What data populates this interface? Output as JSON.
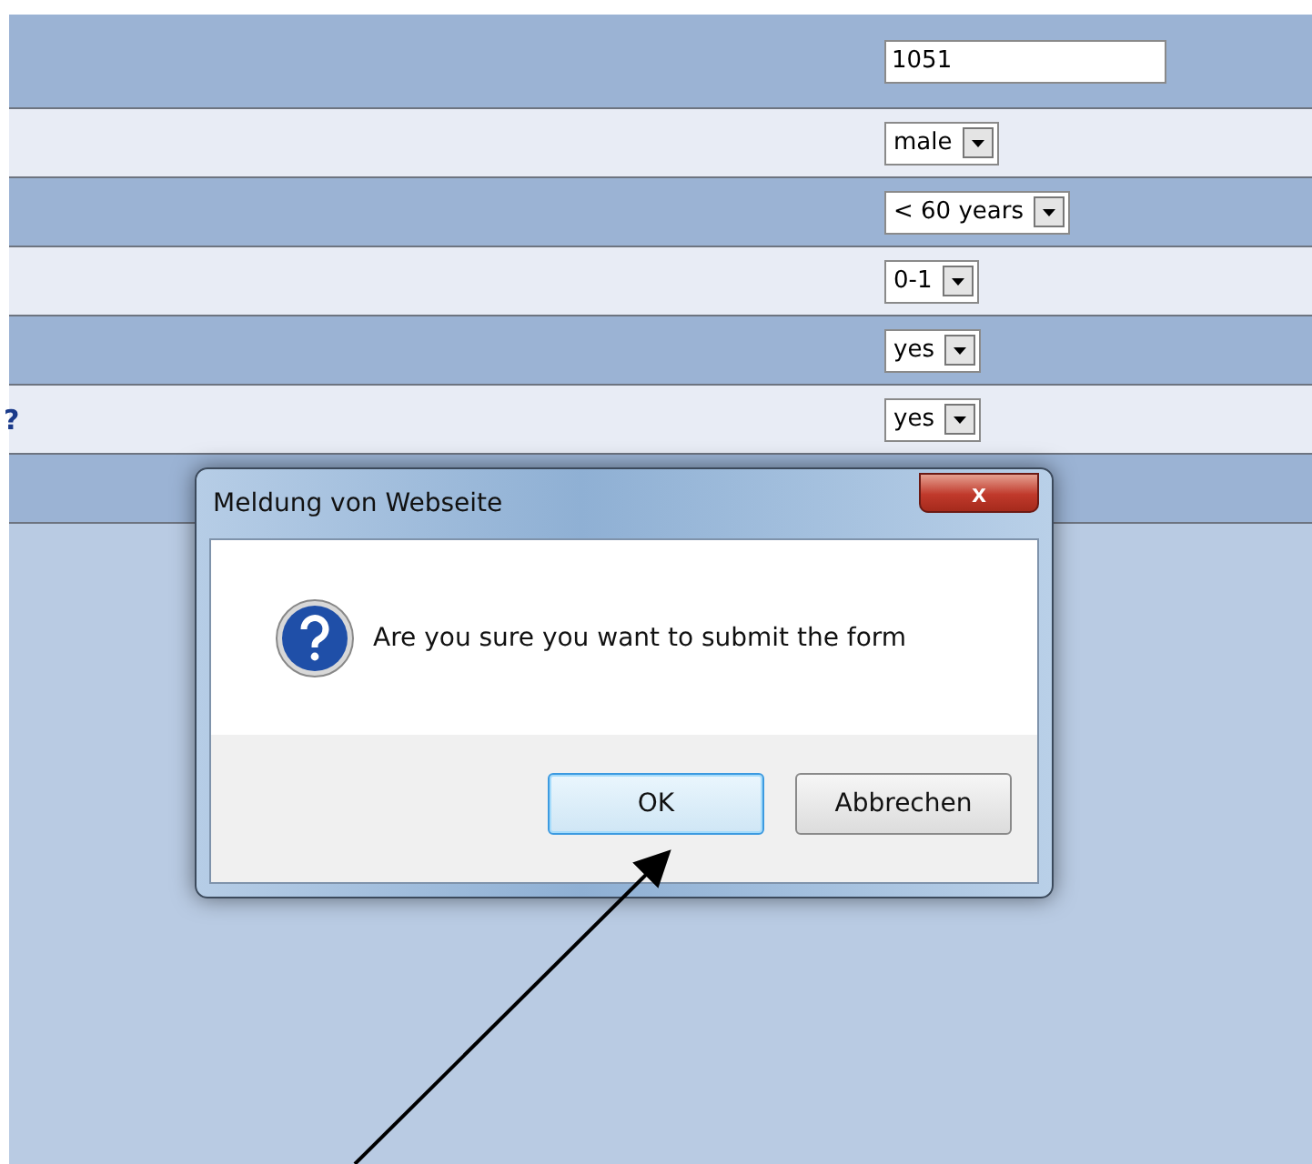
{
  "form": {
    "rows": [
      {
        "kind": "input",
        "value": "1051"
      },
      {
        "kind": "select",
        "value": "male"
      },
      {
        "kind": "select",
        "value": "< 60 years"
      },
      {
        "kind": "select",
        "value": "0-1"
      },
      {
        "kind": "select",
        "value": "yes"
      },
      {
        "kind": "select",
        "label": "?",
        "value": "yes"
      },
      {
        "kind": "blank"
      }
    ]
  },
  "dialog": {
    "title": "Meldung von Webseite",
    "close": "x",
    "message": "Are you sure you want to submit the form",
    "buttons": [
      {
        "label": "OK",
        "selected": true
      },
      {
        "label": "Abbrechen",
        "selected": false
      }
    ]
  }
}
